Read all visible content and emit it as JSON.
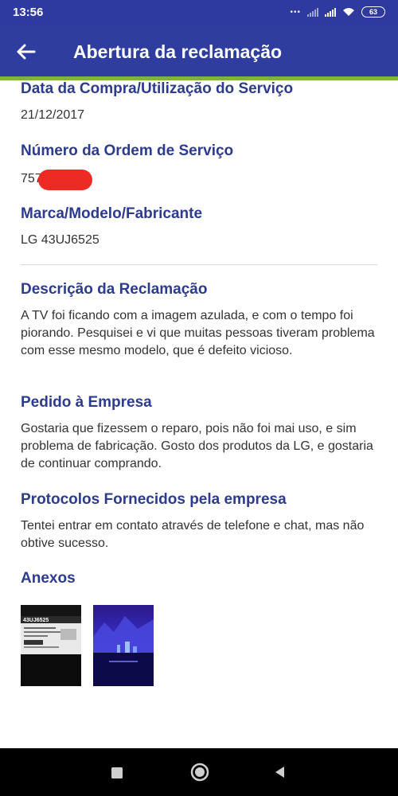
{
  "status": {
    "time": "13:56",
    "battery": "63"
  },
  "appbar": {
    "title": "Abertura da reclamação"
  },
  "fields": {
    "purchase_date_label": "Data da Compra/Utilização do Serviço",
    "purchase_date_value": "21/12/2017",
    "order_label": "Número da Ordem de Serviço",
    "order_value": "757",
    "brand_label": "Marca/Modelo/Fabricante",
    "brand_value": "LG 43UJ6525"
  },
  "complaint": {
    "label": "Descrição da Reclamação",
    "text": "A TV foi ficando com a imagem azulada, e com o tempo foi piorando. Pesquisei e vi que muitas pessoas tiveram problema com esse mesmo modelo, que é defeito vicioso."
  },
  "request": {
    "label": "Pedido à Empresa",
    "text": "Gostaria que fizessem o reparo, pois não foi mai uso, e sim problema de fabricação. Gosto dos produtos da LG, e gostaria de continuar comprando."
  },
  "protocols": {
    "label": "Protocolos Fornecidos pela empresa",
    "text": "Tentei entrar em contato através de telefone e chat, mas não obtive sucesso."
  },
  "attachments": {
    "label": "Anexos",
    "label_text": "43UJ6525"
  },
  "colors": {
    "appbar": "#2f3e9e",
    "accent_line": "#7cb342",
    "section_title": "#2d3b8e",
    "redaction": "#ee2a24"
  },
  "icons": {
    "back": "arrow-left-icon",
    "nav_recent": "square-icon",
    "nav_home": "circle-icon",
    "nav_back": "triangle-icon"
  }
}
